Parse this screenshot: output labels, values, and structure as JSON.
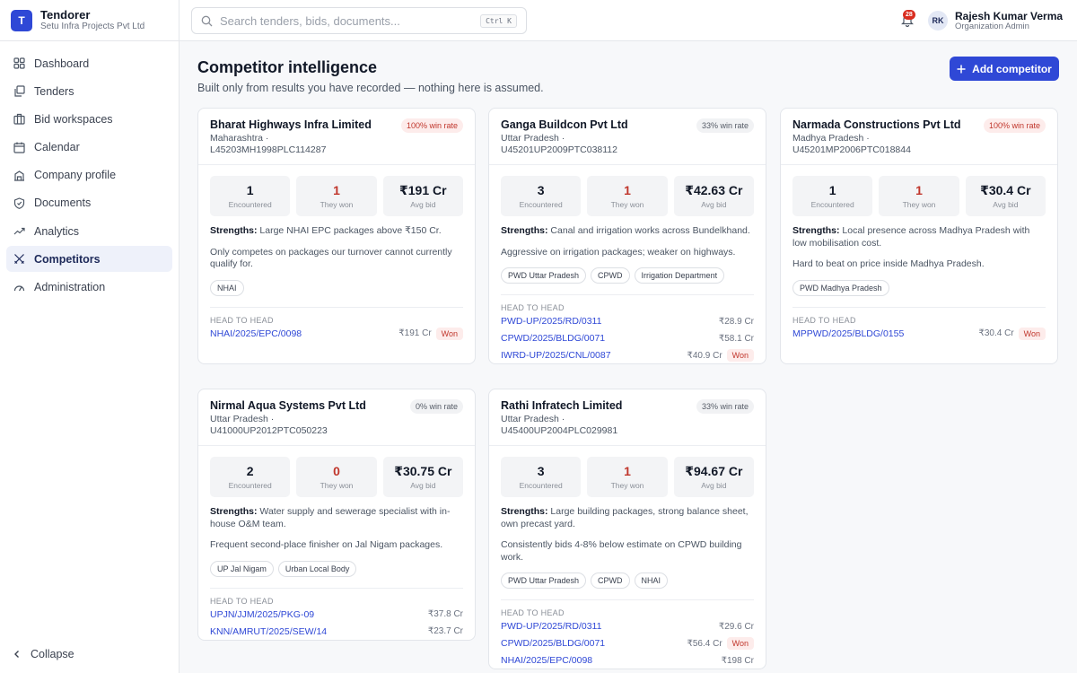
{
  "brand": {
    "initial": "T",
    "name": "Tendorer",
    "org": "Setu Infra Projects Pvt Ltd"
  },
  "nav": [
    {
      "label": "Dashboard",
      "icon": "grid-icon",
      "active": false
    },
    {
      "label": "Tenders",
      "icon": "document-stack-icon",
      "active": false
    },
    {
      "label": "Bid workspaces",
      "icon": "briefcase-icon",
      "active": false
    },
    {
      "label": "Calendar",
      "icon": "calendar-icon",
      "active": false
    },
    {
      "label": "Company profile",
      "icon": "building-icon",
      "active": false
    },
    {
      "label": "Documents",
      "icon": "shield-icon",
      "active": false
    },
    {
      "label": "Analytics",
      "icon": "trend-icon",
      "active": false
    },
    {
      "label": "Competitors",
      "icon": "swords-icon",
      "active": true
    },
    {
      "label": "Administration",
      "icon": "gauge-icon",
      "active": false
    }
  ],
  "collapse_label": "Collapse",
  "search": {
    "placeholder": "Search tenders, bids, documents...",
    "shortcut": "Ctrl K"
  },
  "notifications": {
    "count": "28"
  },
  "user": {
    "initials": "RK",
    "name": "Rajesh Kumar Verma",
    "role": "Organization Admin"
  },
  "page": {
    "title": "Competitor intelligence",
    "subtitle": "Built only from results you have recorded — nothing here is assumed.",
    "add_button": "Add competitor"
  },
  "labels": {
    "encountered": "Encountered",
    "they_won": "They won",
    "avg_bid": "Avg bid",
    "strengths": "Strengths:",
    "head_to_head": "HEAD TO HEAD",
    "won": "Won"
  },
  "competitors": [
    {
      "name": "Bharat Highways Infra Limited",
      "meta": "Maharashtra · L45203MH1998PLC114287",
      "win_rate": "100% win rate",
      "win_style": "red",
      "encountered": "1",
      "they_won": "1",
      "avg_bid": "₹191 Cr",
      "strengths": "Large NHAI EPC packages above ₹150 Cr.",
      "note": "Only competes on packages our turnover cannot currently qualify for.",
      "tags": [
        "NHAI"
      ],
      "h2h": [
        {
          "ref": "NHAI/2025/EPC/0098",
          "amount": "₹191 Cr",
          "won": true
        }
      ]
    },
    {
      "name": "Ganga Buildcon Pvt Ltd",
      "meta": "Uttar Pradesh · U45201UP2009PTC038112",
      "win_rate": "33% win rate",
      "win_style": "grey",
      "encountered": "3",
      "they_won": "1",
      "avg_bid": "₹42.63 Cr",
      "strengths": "Canal and irrigation works across Bundelkhand.",
      "note": "Aggressive on irrigation packages; weaker on highways.",
      "tags": [
        "PWD Uttar Pradesh",
        "CPWD",
        "Irrigation Department"
      ],
      "h2h": [
        {
          "ref": "PWD-UP/2025/RD/0311",
          "amount": "₹28.9 Cr",
          "won": false
        },
        {
          "ref": "CPWD/2025/BLDG/0071",
          "amount": "₹58.1 Cr",
          "won": false
        },
        {
          "ref": "IWRD-UP/2025/CNL/0087",
          "amount": "₹40.9 Cr",
          "won": true
        }
      ]
    },
    {
      "name": "Narmada Constructions Pvt Ltd",
      "meta": "Madhya Pradesh · U45201MP2006PTC018844",
      "win_rate": "100% win rate",
      "win_style": "red",
      "encountered": "1",
      "they_won": "1",
      "avg_bid": "₹30.4 Cr",
      "strengths": "Local presence across Madhya Pradesh with low mobilisation cost.",
      "note": "Hard to beat on price inside Madhya Pradesh.",
      "tags": [
        "PWD Madhya Pradesh"
      ],
      "h2h": [
        {
          "ref": "MPPWD/2025/BLDG/0155",
          "amount": "₹30.4 Cr",
          "won": true
        }
      ]
    },
    {
      "name": "Nirmal Aqua Systems Pvt Ltd",
      "meta": "Uttar Pradesh · U41000UP2012PTC050223",
      "win_rate": "0% win rate",
      "win_style": "grey",
      "encountered": "2",
      "they_won": "0",
      "avg_bid": "₹30.75 Cr",
      "strengths": "Water supply and sewerage specialist with in-house O&M team.",
      "note": "Frequent second-place finisher on Jal Nigam packages.",
      "tags": [
        "UP Jal Nigam",
        "Urban Local Body"
      ],
      "h2h": [
        {
          "ref": "UPJN/JJM/2025/PKG-09",
          "amount": "₹37.8 Cr",
          "won": false
        },
        {
          "ref": "KNN/AMRUT/2025/SEW/14",
          "amount": "₹23.7 Cr",
          "won": false
        }
      ]
    },
    {
      "name": "Rathi Infratech Limited",
      "meta": "Uttar Pradesh · U45400UP2004PLC029981",
      "win_rate": "33% win rate",
      "win_style": "grey",
      "encountered": "3",
      "they_won": "1",
      "avg_bid": "₹94.67 Cr",
      "strengths": "Large building packages, strong balance sheet, own precast yard.",
      "note": "Consistently bids 4-8% below estimate on CPWD building work.",
      "tags": [
        "PWD Uttar Pradesh",
        "CPWD",
        "NHAI"
      ],
      "h2h": [
        {
          "ref": "PWD-UP/2025/RD/0311",
          "amount": "₹29.6 Cr",
          "won": false
        },
        {
          "ref": "CPWD/2025/BLDG/0071",
          "amount": "₹56.4 Cr",
          "won": true
        },
        {
          "ref": "NHAI/2025/EPC/0098",
          "amount": "₹198 Cr",
          "won": false
        }
      ]
    }
  ]
}
